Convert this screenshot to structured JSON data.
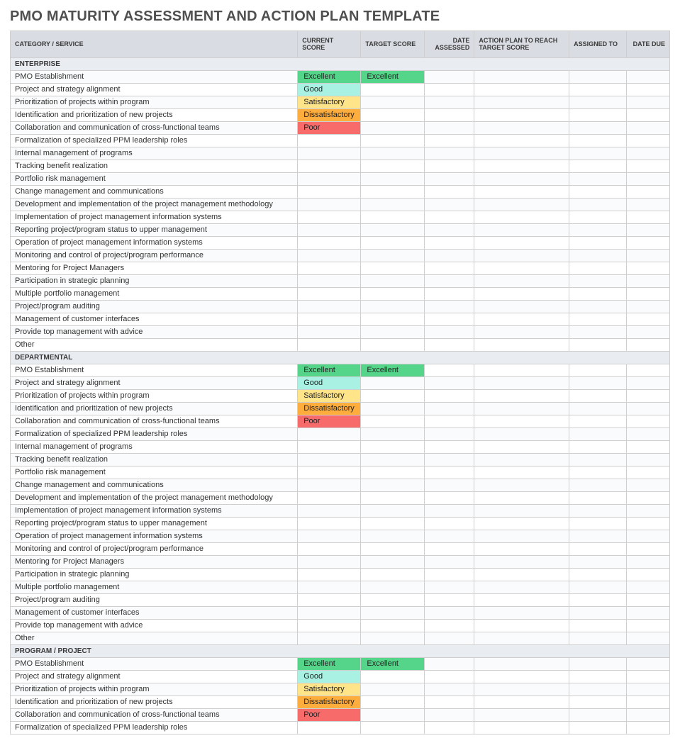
{
  "title": "PMO MATURITY ASSESSMENT AND ACTION PLAN TEMPLATE",
  "columns": {
    "category": "CATEGORY / SERVICE",
    "current": "CURRENT SCORE",
    "target": "TARGET SCORE",
    "date_assessed": "DATE ASSESSED",
    "action_plan": "ACTION PLAN TO REACH TARGET SCORE",
    "assigned_to": "ASSIGNED TO",
    "date_due": "DATE DUE"
  },
  "score_labels": {
    "excellent": "Excellent",
    "good": "Good",
    "satisfactory": "Satisfactory",
    "dissatisfactory": "Dissatisfactory",
    "poor": "Poor"
  },
  "common_items": [
    "PMO Establishment",
    "Project and strategy alignment",
    "Prioritization of projects within program",
    "Identification and prioritization of new projects",
    "Collaboration and communication of cross-functional teams",
    "Formalization of specialized PPM leadership roles",
    "Internal management of programs",
    "Tracking benefit realization",
    "Portfolio risk management",
    "Change management and communications",
    "Development and implementation of the project management methodology",
    "Implementation of project management information systems",
    "Reporting project/program status to upper management",
    "Operation of project management information systems",
    "Monitoring and control of project/program performance",
    "Mentoring for Project Managers",
    "Participation in strategic planning",
    "Multiple portfolio management",
    "Project/program auditing",
    "Management of customer interfaces",
    "Provide top management with advice",
    "Other"
  ],
  "sections": [
    {
      "name": "ENTERPRISE",
      "rows": [
        {
          "current": "excellent",
          "target": "excellent"
        },
        {
          "current": "good"
        },
        {
          "current": "satisfactory"
        },
        {
          "current": "dissatisfactory"
        },
        {
          "current": "poor"
        },
        {},
        {},
        {},
        {},
        {},
        {},
        {},
        {},
        {},
        {},
        {},
        {},
        {},
        {},
        {},
        {},
        {}
      ],
      "show_all": true
    },
    {
      "name": "DEPARTMENTAL",
      "rows": [
        {
          "current": "excellent",
          "target": "excellent"
        },
        {
          "current": "good"
        },
        {
          "current": "satisfactory"
        },
        {
          "current": "dissatisfactory"
        },
        {
          "current": "poor"
        },
        {},
        {},
        {},
        {},
        {},
        {},
        {},
        {},
        {},
        {},
        {},
        {},
        {},
        {},
        {},
        {},
        {}
      ],
      "show_all": true
    },
    {
      "name": "PROGRAM / PROJECT",
      "rows": [
        {
          "current": "excellent",
          "target": "excellent"
        },
        {
          "current": "good"
        },
        {
          "current": "satisfactory"
        },
        {
          "current": "dissatisfactory"
        },
        {
          "current": "poor"
        },
        {}
      ],
      "show_all": false
    }
  ]
}
